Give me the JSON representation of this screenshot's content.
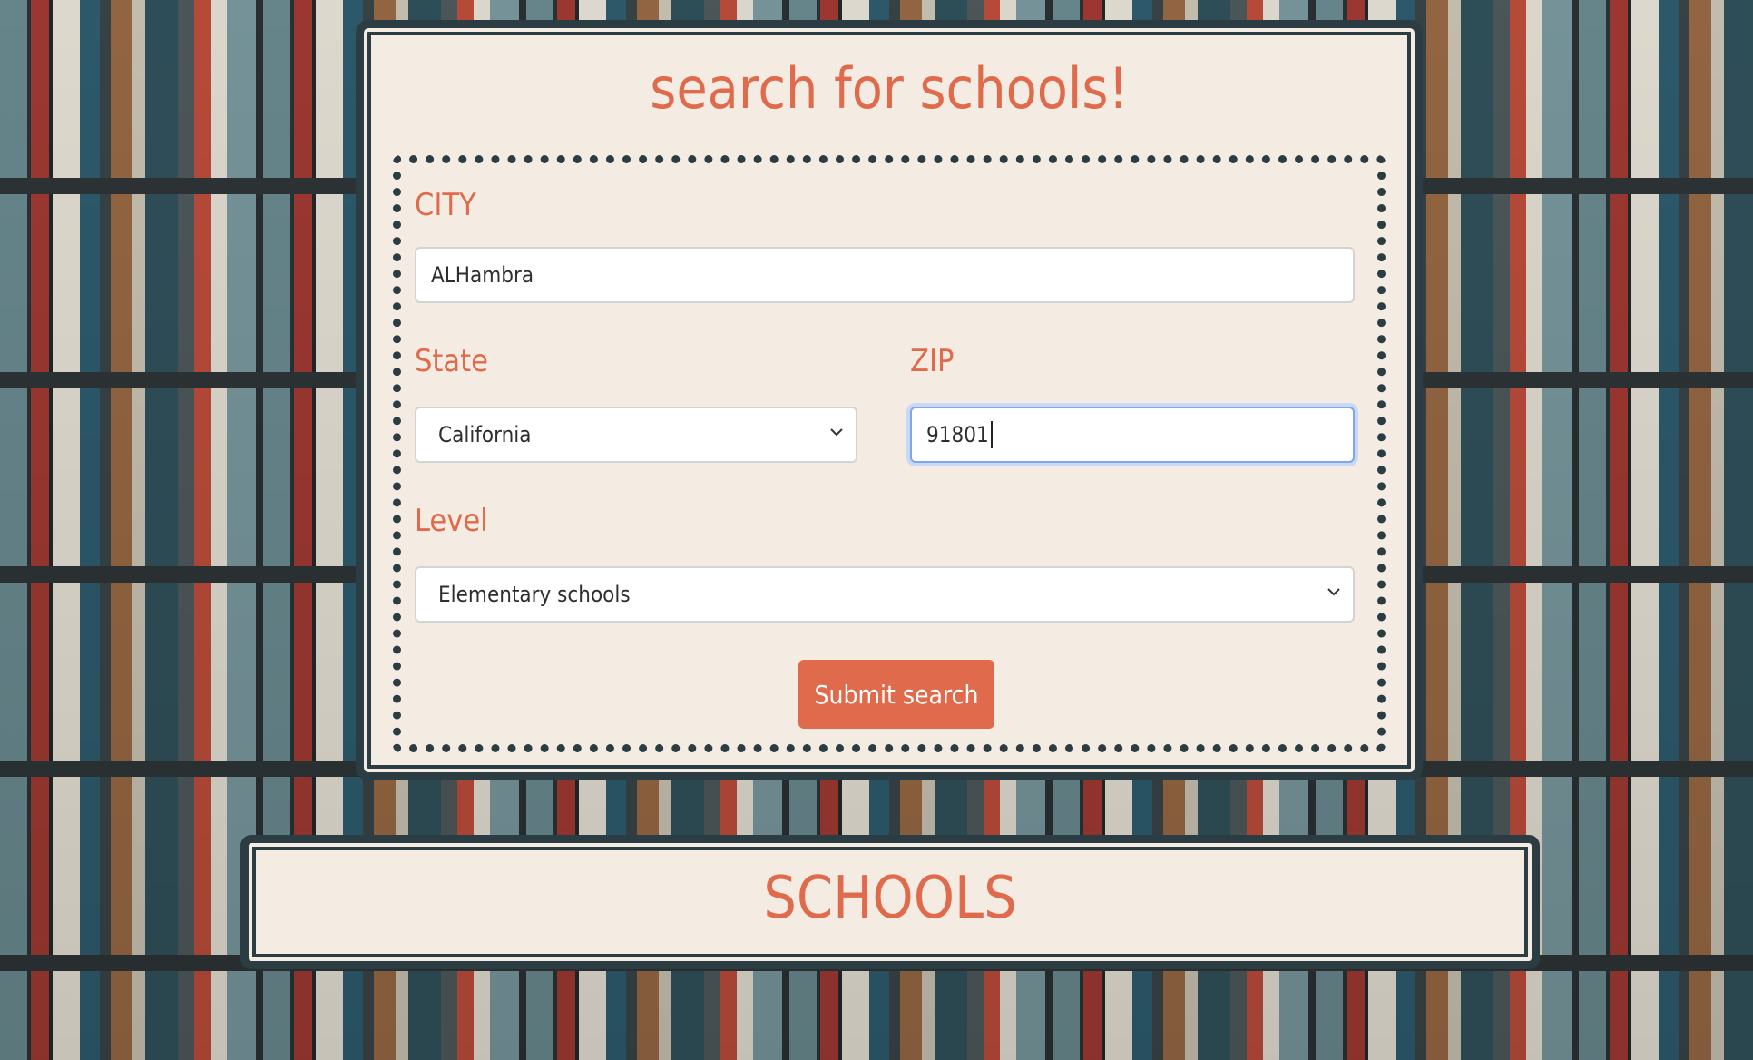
{
  "search": {
    "title": "search for schools!",
    "city": {
      "label": "CITY",
      "value": "ALHambra"
    },
    "state": {
      "label": "State",
      "selected": "California"
    },
    "zip": {
      "label": "ZIP",
      "value": "91801"
    },
    "level": {
      "label": "Level",
      "selected": "Elementary schools"
    },
    "submit_label": "Submit search"
  },
  "results": {
    "title": "SCHOOLS"
  },
  "colors": {
    "accent": "#e06b4c",
    "card_bg": "#f4ece2",
    "border": "#2b3d43"
  },
  "icons": {
    "select_arrow": "chevron-down-icon"
  }
}
